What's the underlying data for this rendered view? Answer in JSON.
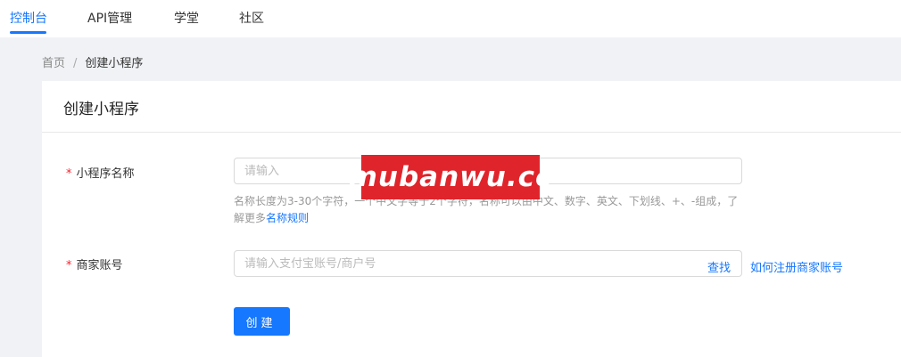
{
  "nav": {
    "items": [
      {
        "label": "控制台",
        "active": true
      },
      {
        "label": "API管理",
        "active": false
      },
      {
        "label": "学堂",
        "active": false
      },
      {
        "label": "社区",
        "active": false
      }
    ]
  },
  "breadcrumb": {
    "home": "首页",
    "separator": "/",
    "current": "创建小程序"
  },
  "card": {
    "title": "创建小程序"
  },
  "form": {
    "name": {
      "required_mark": "*",
      "label": "小程序名称",
      "placeholder": "请输入",
      "value": "",
      "help_text": "名称长度为3-30个字符，一个中文字等于2个字符，名称可以由中文、数字、英文、下划线、+、-组成，了解更多",
      "help_link": "名称规则"
    },
    "merchant": {
      "required_mark": "*",
      "label": "商家账号",
      "placeholder": "请输入支付宝账号/商户号",
      "value": "",
      "lookup_label": "查找",
      "register_link": "如何注册商家账号"
    },
    "submit_label": "创建"
  },
  "watermark": {
    "text": "mubanwu.cc"
  },
  "colors": {
    "accent": "#1677ff",
    "required": "#f5222d",
    "watermark_bg": "#e0242b",
    "page_bg": "#f0f2f5"
  }
}
